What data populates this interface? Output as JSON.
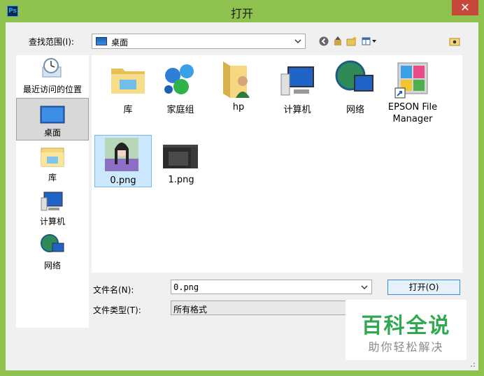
{
  "window": {
    "title": "打开",
    "app_icon": "Ps",
    "close_icon": "close-icon"
  },
  "lookin": {
    "label": "查找范围(I):",
    "value": "桌面"
  },
  "sidebar": {
    "items": [
      {
        "label": "最近访问的位置",
        "icon": "recent-places-icon"
      },
      {
        "label": "桌面",
        "icon": "desktop-icon",
        "selected": true
      },
      {
        "label": "库",
        "icon": "libraries-icon"
      },
      {
        "label": "计算机",
        "icon": "computer-icon"
      },
      {
        "label": "网络",
        "icon": "network-icon"
      }
    ]
  },
  "files": [
    {
      "name": "库",
      "icon": "libraries-folder-icon"
    },
    {
      "name": "家庭组",
      "icon": "homegroup-icon"
    },
    {
      "name": "hp",
      "icon": "user-folder-icon"
    },
    {
      "name": "计算机",
      "icon": "computer-icon"
    },
    {
      "name": "网络",
      "icon": "network-icon"
    },
    {
      "name": "EPSON File Manager",
      "line1": "EPSON File",
      "line2": "Manager",
      "icon": "epson-shortcut-icon"
    },
    {
      "name": "0.png",
      "icon": "image-thumbnail-icon",
      "selected": true
    },
    {
      "name": "1.png",
      "icon": "image-thumbnail-icon"
    }
  ],
  "bottom": {
    "filename_label": "文件名(N):",
    "filename_value": "0.png",
    "filetype_label": "文件类型(T):",
    "filetype_value": "所有格式",
    "open_label": "打开(O)"
  },
  "watermark": {
    "title": "百科全说",
    "subtitle": "助你轻松解决"
  }
}
